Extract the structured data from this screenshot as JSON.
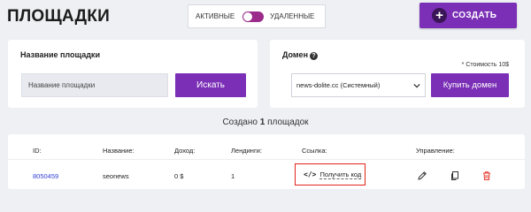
{
  "page": {
    "title": "ПЛОЩАДКИ"
  },
  "toggle": {
    "left_label": "АКТИВНЫЕ",
    "right_label": "УДАЛЕННЫЕ"
  },
  "create_button": {
    "label": "СОЗДАТЬ",
    "icon": "plus-icon"
  },
  "search_panel": {
    "title": "Название площадки",
    "input_placeholder": "Название площадки",
    "search_button": "Искать"
  },
  "domain_panel": {
    "title": "Домен",
    "help_icon": "question-circle-icon",
    "cost_note": "* Стоимость 10$",
    "selected_domain": "news-dolite.cc (Системный)",
    "buy_button": "Купить домен"
  },
  "summary": {
    "prefix": "Создано ",
    "count": "1",
    "suffix": " площадок"
  },
  "table": {
    "headers": {
      "id": "ID:",
      "name": "Название:",
      "income": "Доход:",
      "landings": "Лендинги:",
      "link": "Ссылка:",
      "manage": "Управление:"
    },
    "rows": [
      {
        "id": "8050459",
        "name": "seonews",
        "income": "0 $",
        "landings": "1",
        "link_label": "Получить код",
        "link_icon": "code-icon"
      }
    ],
    "action_icons": [
      "pencil-icon",
      "copy-icon",
      "trash-icon"
    ]
  },
  "colors": {
    "accent": "#7a2fb6",
    "toggle": "#9b2a8a",
    "highlight_border": "#e2231a",
    "delete": "#e8352b",
    "link": "#2f3fd8"
  }
}
